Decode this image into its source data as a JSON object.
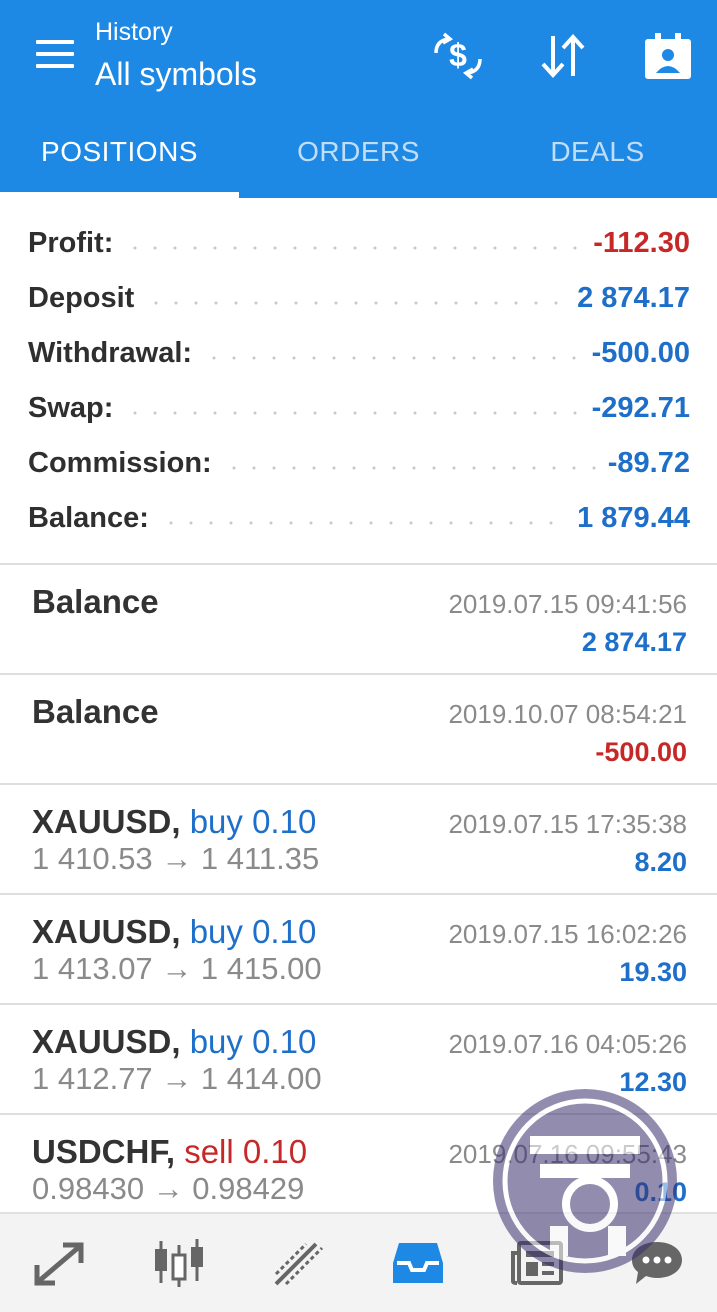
{
  "header": {
    "subtitle": "History",
    "title": "All symbols",
    "actions": [
      {
        "icon": "currency-exchange-icon"
      },
      {
        "icon": "sort-icon"
      },
      {
        "icon": "calendar-icon"
      }
    ]
  },
  "tabs": [
    {
      "label": "POSITIONS",
      "active": true
    },
    {
      "label": "ORDERS",
      "active": false
    },
    {
      "label": "DEALS",
      "active": false
    }
  ],
  "summary": [
    {
      "label": "Profit:",
      "value": "-112.30",
      "color": "#c62828"
    },
    {
      "label": "Deposit",
      "value": "2 874.17",
      "color": "#1e6fc9"
    },
    {
      "label": "Withdrawal:",
      "value": "-500.00",
      "color": "#1e6fc9"
    },
    {
      "label": "Swap:",
      "value": "-292.71",
      "color": "#1e6fc9"
    },
    {
      "label": "Commission:",
      "value": "-89.72",
      "color": "#1e6fc9"
    },
    {
      "label": "Balance:",
      "value": "1 879.44",
      "color": "#1e6fc9"
    }
  ],
  "entries": [
    {
      "title": "Balance",
      "time": "2019.07.15 09:41:56",
      "profit": "2 874.17",
      "profit_color": "#1e6fc9"
    },
    {
      "title": "Balance",
      "time": "2019.10.07 08:54:21",
      "profit": "-500.00",
      "profit_color": "#c62828"
    },
    {
      "symbol": "XAUUSD,",
      "direction": "buy 0.10",
      "prices": "1 410.53 → 1 411.35",
      "time": "2019.07.15 17:35:38",
      "profit": "8.20",
      "profit_color": "#1e6fc9"
    },
    {
      "symbol": "XAUUSD,",
      "direction": "buy 0.10",
      "prices": "1 413.07 → 1 415.00",
      "time": "2019.07.15 16:02:26",
      "profit": "19.30",
      "profit_color": "#1e6fc9"
    },
    {
      "symbol": "XAUUSD,",
      "direction": "buy 0.10",
      "prices": "1 412.77 → 1 414.00",
      "time": "2019.07.16 04:05:26",
      "profit": "12.30",
      "profit_color": "#1e6fc9"
    },
    {
      "symbol": "USDCHF,",
      "direction": "sell 0.10",
      "prices": "0.98430 → 0.98429",
      "time": "2019.07.16 09:55:43",
      "profit": "0.10",
      "profit_color": "#1e6fc9"
    }
  ],
  "bottom_nav": [
    {
      "icon": "quotes-arrows-icon",
      "active": false
    },
    {
      "icon": "candlestick-chart-icon",
      "active": false
    },
    {
      "icon": "trend-line-icon",
      "active": false
    },
    {
      "icon": "inbox-history-icon",
      "active": true
    },
    {
      "icon": "news-icon",
      "active": false
    },
    {
      "icon": "chat-icon",
      "active": false
    }
  ],
  "colors": {
    "accent": "#1e88e5",
    "negative": "#c62828",
    "positive": "#1e6fc9"
  }
}
